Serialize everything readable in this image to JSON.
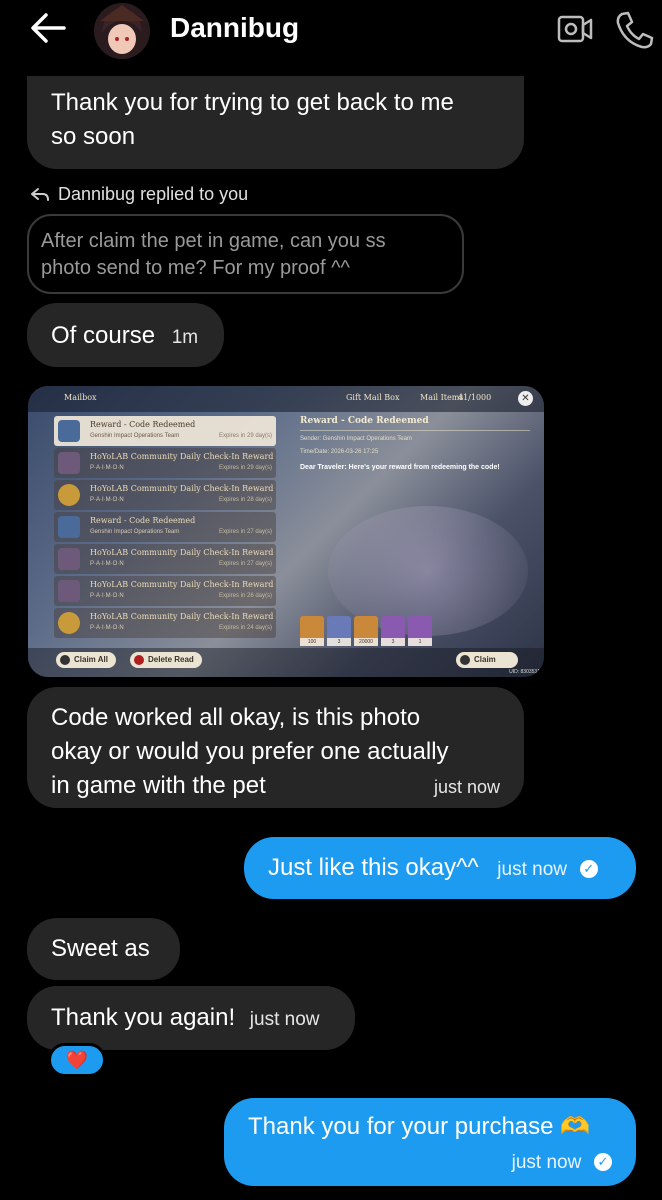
{
  "header": {
    "contact_name": "Dannibug",
    "back_icon": "arrow-left-icon",
    "video_icon": "video-call-icon",
    "call_icon": "phone-icon"
  },
  "colors": {
    "background": "#000000",
    "incoming_bubble": "#262626",
    "outgoing_bubble": "#1d9bf0"
  },
  "messages": {
    "m1": {
      "text_line1": "Thank you for trying to get back to me",
      "text_line2": "so soon"
    },
    "reply_label": "Dannibug replied to you",
    "reply_quote_line1": "After claim the pet in game, can you ss",
    "reply_quote_line2": "photo send to me? For my proof ^^",
    "m2": {
      "text": "Of course",
      "time": "1m"
    },
    "m3": {
      "line1": "Code worked all okay, is this photo",
      "line2": "okay or would you prefer one actually",
      "line3": "in game with the pet",
      "time": "just now"
    },
    "m4": {
      "text": "Just like this okay^^",
      "time": "just now"
    },
    "m5": {
      "text": "Sweet as"
    },
    "m6": {
      "text": "Thank you again!",
      "time": "just now"
    },
    "reaction": "❤️",
    "m7": {
      "text": "Thank you for your purchase 🫶",
      "time": "just now"
    }
  },
  "screenshot": {
    "mailbox_title": "Mailbox",
    "gift_mail_box": "Gift Mail Box",
    "mail_items": "Mail Items",
    "mail_count": "41/1000",
    "items": [
      {
        "title": "Reward - Code Redeemed",
        "sender": "Genshin Impact Operations Team",
        "expires": "Expires in 29 day(s)",
        "icon": "star"
      },
      {
        "title": "HoYoLAB Community Daily Check-In Reward",
        "sender": "P·A·I·M·O·N",
        "expires": "Expires in 29 day(s)",
        "icon": "book"
      },
      {
        "title": "HoYoLAB Community Daily Check-In Reward",
        "sender": "P·A·I·M·O·N",
        "expires": "Expires in 28 day(s)",
        "icon": "coin"
      },
      {
        "title": "Reward - Code Redeemed",
        "sender": "Genshin Impact Operations Team",
        "expires": "Expires in 27 day(s)",
        "icon": "star"
      },
      {
        "title": "HoYoLAB Community Daily Check-In Reward",
        "sender": "P·A·I·M·O·N",
        "expires": "Expires in 27 day(s)",
        "icon": "book"
      },
      {
        "title": "HoYoLAB Community Daily Check-In Reward",
        "sender": "P·A·I·M·O·N",
        "expires": "Expires in 26 day(s)",
        "icon": "book"
      },
      {
        "title": "HoYoLAB Community Daily Check-In Reward",
        "sender": "P·A·I·M·O·N",
        "expires": "Expires in 24 day(s)",
        "icon": "coin"
      }
    ],
    "detail_title": "Reward - Code Redeemed",
    "detail_sender": "Sender: Genshin Impact Operations Team",
    "detail_time": "Time/Date: 2026-03-26 17:25",
    "detail_body": "Dear Traveler: Here's your reward from redeeming the code!",
    "reward_qty": [
      "100",
      "3",
      "20000",
      "3",
      "1"
    ],
    "claim_all": "Claim All",
    "delete_read": "Delete Read",
    "claim": "Claim",
    "uid": "UID: 8303531"
  }
}
